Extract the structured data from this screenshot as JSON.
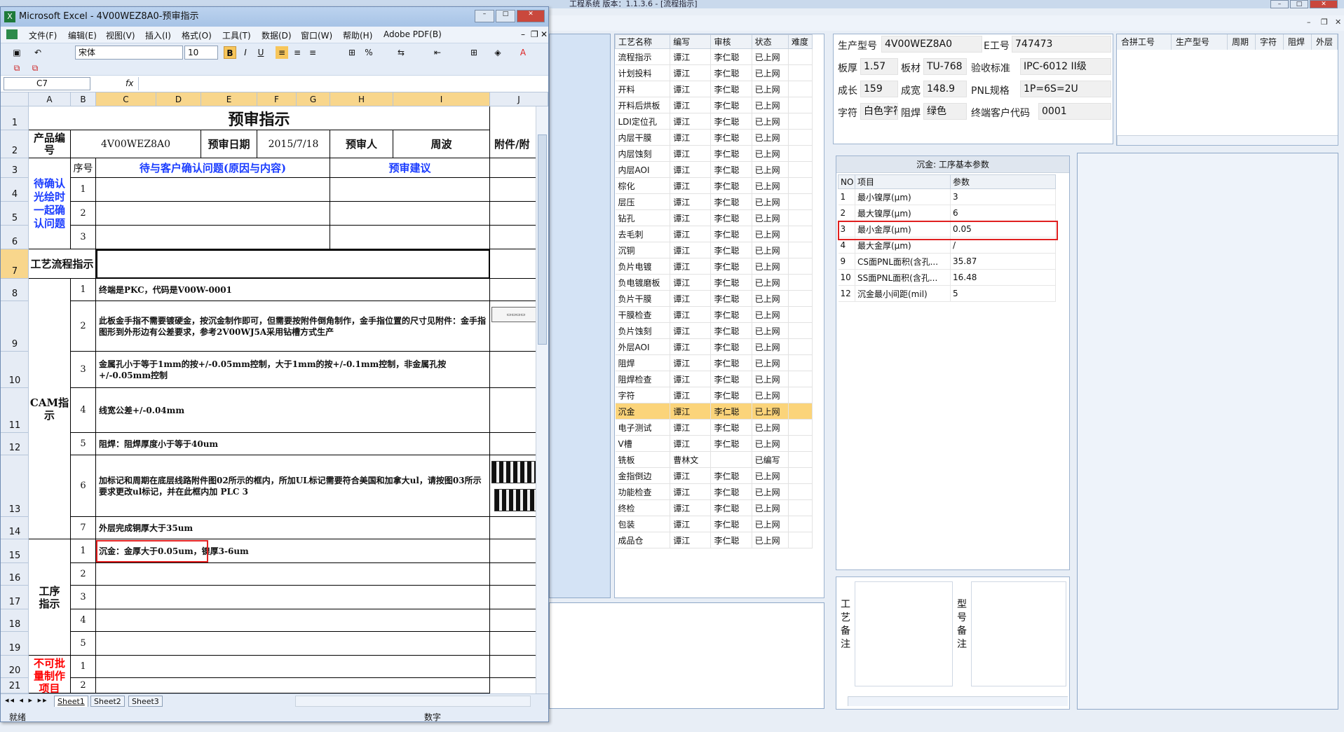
{
  "app": {
    "title": "工程系统  版本：1.1.3.6 - [流程指示]"
  },
  "excel": {
    "title": "Microsoft Excel - 4V00WEZ8A0-预审指示",
    "menu": [
      "文件(F)",
      "编辑(E)",
      "视图(V)",
      "插入(I)",
      "格式(O)",
      "工具(T)",
      "数据(D)",
      "窗口(W)",
      "帮助(H)",
      "Adobe PDF(B)"
    ],
    "font_name": "宋体",
    "font_size": "10",
    "name_box": "C7",
    "fx": "fx",
    "columns": [
      "A",
      "B",
      "C",
      "D",
      "E",
      "F",
      "G",
      "H",
      "I",
      "J"
    ],
    "rows": [
      "1",
      "2",
      "3",
      "4",
      "5",
      "6",
      "7",
      "8",
      "9",
      "10",
      "11",
      "12",
      "13",
      "14",
      "15",
      "16",
      "17",
      "18",
      "19",
      "20",
      "21"
    ],
    "sheet_title": "预审指示",
    "r2": {
      "a": "产品编号",
      "c": "4V00WEZ8A0",
      "e": "预审日期",
      "f": "2015/7/18",
      "h": "预审人",
      "i": "周波",
      "j": "附件/附"
    },
    "r3": {
      "b": "序号",
      "c": "待与客户确认问题(原因与内容)",
      "h": "预审建议"
    },
    "confirm_label": "待确认光绘时一起确认问题",
    "nums": [
      "1",
      "2",
      "3",
      "4",
      "5",
      "6",
      "7"
    ],
    "flow_label": "工艺流程指示",
    "cam_label": "CAM指示",
    "cam_items": [
      "终端是PKC，代码是V00W-0001",
      "此板金手指不需要镀硬金，按沉金制作即可，但需要按附件倒角制作，金手指位置的尺寸见附件：金手指图形到外形边有公差要求，参考2V00WJ5A采用钻槽方式生产",
      "金属孔小于等于1mm的按+/-0.05mm控制，大于1mm的按+/-0.1mm控制，非金属孔按+/-0.05mm控制",
      "线宽公差+/-0.04mm",
      "阻焊：阻焊厚度小于等于40um",
      "加标记和周期在底层线路附件图02所示的框内，所加UL标记需要符合美国和加拿大ul，请按图03所示要求更改ul标记，并在此框内加 PLC 3",
      "外层完成铜厚大于35um"
    ],
    "proc_label": "工序指示",
    "proc_item1": "沉金：金厚大于0.05um，镍厚3-6um",
    "batch_label": "不可批量制作项目",
    "sheets": [
      "Sheet1",
      "Sheet2",
      "Sheet3"
    ],
    "status_left": "就绪",
    "status_right": "数字"
  },
  "process": {
    "headers": [
      "工艺名称",
      "编写",
      "审核",
      "状态",
      "难度"
    ],
    "rows": [
      [
        "流程指示",
        "谭江",
        "李仁聪",
        "已上网"
      ],
      [
        "计划投料",
        "谭江",
        "李仁聪",
        "已上网"
      ],
      [
        "开料",
        "谭江",
        "李仁聪",
        "已上网"
      ],
      [
        "开料后烘板",
        "谭江",
        "李仁聪",
        "已上网"
      ],
      [
        "LDI定位孔",
        "谭江",
        "李仁聪",
        "已上网"
      ],
      [
        "内层干膜",
        "谭江",
        "李仁聪",
        "已上网"
      ],
      [
        "内层蚀刻",
        "谭江",
        "李仁聪",
        "已上网"
      ],
      [
        "内层AOI",
        "谭江",
        "李仁聪",
        "已上网"
      ],
      [
        "棕化",
        "谭江",
        "李仁聪",
        "已上网"
      ],
      [
        "层压",
        "谭江",
        "李仁聪",
        "已上网"
      ],
      [
        "钻孔",
        "谭江",
        "李仁聪",
        "已上网"
      ],
      [
        "去毛刺",
        "谭江",
        "李仁聪",
        "已上网"
      ],
      [
        "沉铜",
        "谭江",
        "李仁聪",
        "已上网"
      ],
      [
        "负片电镀",
        "谭江",
        "李仁聪",
        "已上网"
      ],
      [
        "负电镀磨板",
        "谭江",
        "李仁聪",
        "已上网"
      ],
      [
        "负片干膜",
        "谭江",
        "李仁聪",
        "已上网"
      ],
      [
        "干膜检查",
        "谭江",
        "李仁聪",
        "已上网"
      ],
      [
        "负片蚀刻",
        "谭江",
        "李仁聪",
        "已上网"
      ],
      [
        "外层AOI",
        "谭江",
        "李仁聪",
        "已上网"
      ],
      [
        "阻焊",
        "谭江",
        "李仁聪",
        "已上网"
      ],
      [
        "阻焊检查",
        "谭江",
        "李仁聪",
        "已上网"
      ],
      [
        "字符",
        "谭江",
        "李仁聪",
        "已上网"
      ],
      [
        "沉金",
        "谭江",
        "李仁聪",
        "已上网"
      ],
      [
        "电子测试",
        "谭江",
        "李仁聪",
        "已上网"
      ],
      [
        "V槽",
        "谭江",
        "李仁聪",
        "已上网"
      ],
      [
        "铣板",
        "曹林文",
        "",
        "已编写"
      ],
      [
        "金指倒边",
        "谭江",
        "李仁聪",
        "已上网"
      ],
      [
        "功能检查",
        "谭江",
        "李仁聪",
        "已上网"
      ],
      [
        "终检",
        "谭江",
        "李仁聪",
        "已上网"
      ],
      [
        "包装",
        "谭江",
        "李仁聪",
        "已上网"
      ],
      [
        "成品仓",
        "谭江",
        "李仁聪",
        "已上网"
      ]
    ]
  },
  "info": {
    "model_label": "生产型号",
    "model": "4V00WEZ8A0",
    "eno_label": "E工号",
    "eno": "747473",
    "thick_label": "板厚",
    "thick": "1.57",
    "mat_label": "板材",
    "mat": "TU-768",
    "std_label": "验收标准",
    "std": "IPC-6012 II级",
    "len_label": "成长",
    "len": "159",
    "wid_label": "成宽",
    "wid": "148.9",
    "pnl_label": "PNL规格",
    "pnl": "1P=6S=2U",
    "char_label": "字符",
    "char": "白色字符",
    "mask_label": "阻焊",
    "mask": "绿色",
    "cust_label": "终端客户代码",
    "cust": "0001"
  },
  "merge": {
    "headers": [
      "合拼工号",
      "生产型号",
      "周期",
      "字符",
      "阻焊",
      "外层"
    ]
  },
  "params": {
    "caption": "沉金: 工序基本参数",
    "headers": [
      "NO",
      "项目",
      "参数"
    ],
    "rows": [
      [
        "1",
        "最小镍厚(μm)",
        "3"
      ],
      [
        "2",
        "最大镍厚(μm)",
        "6"
      ],
      [
        "3",
        "最小金厚(μm)",
        "0.05"
      ],
      [
        "4",
        "最大金厚(μm)",
        "/"
      ],
      [
        "9",
        "CS面PNL面积(含孔...",
        "35.87"
      ],
      [
        "10",
        "SS面PNL面积(含孔...",
        "16.48"
      ],
      [
        "12",
        "沉金最小间距(mil)",
        "5"
      ]
    ]
  },
  "remarks": {
    "proc_label": "工艺备注",
    "model_label": "型号备注"
  }
}
